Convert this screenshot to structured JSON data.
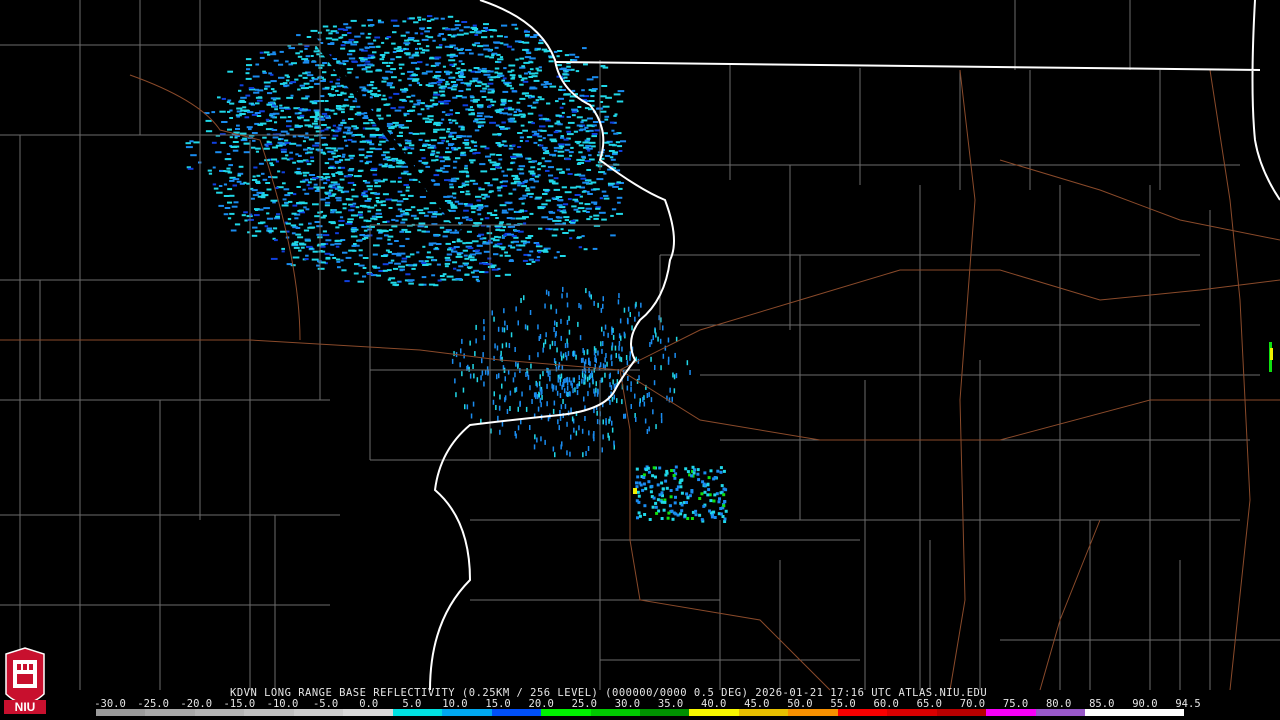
{
  "product": {
    "caption": "KDVN LONG RANGE BASE REFLECTIVITY (0.25KM / 256 LEVEL) (000000/0000 0.5 DEG) 2026-01-21 17:16 UTC  ATLAS.NIU.EDU",
    "logo_text": "NIU"
  },
  "scale": {
    "labels": [
      "-30.0",
      "-25.0",
      "-20.0",
      "-15.0",
      "-10.0",
      "-5.0",
      "0.0",
      "5.0",
      "10.0",
      "15.0",
      "20.0",
      "25.0",
      "30.0",
      "35.0",
      "40.0",
      "45.0",
      "50.0",
      "55.0",
      "60.0",
      "65.0",
      "70.0",
      "75.0",
      "80.0",
      "85.0",
      "90.0",
      "94.5"
    ],
    "colors": [
      "#9a9a9a",
      "#a8a8a8",
      "#b4b4b4",
      "#c0c0c0",
      "#cccccc",
      "#d8d8d8",
      "#00e0e0",
      "#00a8f0",
      "#0050f8",
      "#00f000",
      "#00c800",
      "#009000",
      "#f8f800",
      "#e8c000",
      "#f89000",
      "#f80000",
      "#d80000",
      "#b80000",
      "#f800f8",
      "#9858c8",
      "#ffffff",
      "#ffffff"
    ]
  },
  "map_colors": {
    "background": "#000000",
    "county_lines": "#6c6c6c",
    "state_lines": "#ffffff",
    "highways": "#8a4a2a",
    "echo_light": "#20d8e8",
    "echo_blue": "#1a8cf0",
    "echo_deep": "#1040e0",
    "echo_green": "#10e010",
    "echo_yellow": "#f0f000"
  }
}
